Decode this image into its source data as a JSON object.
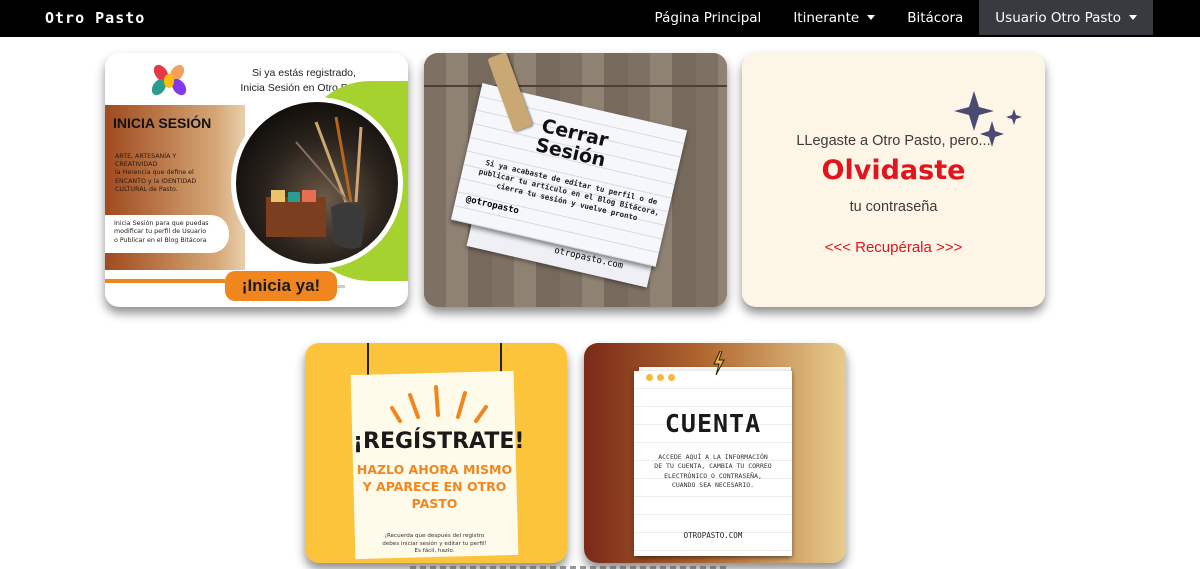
{
  "navbar": {
    "brand": "Otro Pasto",
    "items": [
      {
        "label": "Página Principal"
      },
      {
        "label": "Itinerante"
      },
      {
        "label": "Bitácora"
      },
      {
        "label": "Usuario Otro Pasto"
      }
    ]
  },
  "cards": {
    "login": {
      "top_line1": "Si ya estás registrado,",
      "top_line2": "Inicia Sesión en Otro Pasto",
      "heading": "INICIA SESIÓN",
      "desc1": "ARTE, ARTESANÍA Y",
      "desc2": "CREATIVIDAD",
      "desc3": "la Herencia que define el",
      "desc4": "ENCANTO y la IDENTIDAD",
      "desc5": "CULTURAL de Pasto.",
      "note1": "Inicia Sesión para que puedas",
      "note2": "modificar tu perfil de Usuario",
      "note3": "o Publicar en el Blog Bitácora",
      "cta": "¡Inicia ya!"
    },
    "logout": {
      "title1": "Cerrar",
      "title2": "Sesión",
      "text1": "Si ya acabaste de editar tu perfil o de",
      "text2": "publicar tu artículo en el Blog Bitácora,",
      "text3": "cierra tu sesión y vuelve pronto",
      "handle": "@otropasto",
      "site": "otropasto.com"
    },
    "forgot": {
      "line1": "LLegaste a Otro Pasto, pero...",
      "line2": "Olvidaste",
      "line3": "tu contraseña",
      "link": "<<< Recupérala >>>"
    },
    "register": {
      "title": "¡REGÍSTRATE!",
      "sub1": "HAZLO AHORA MISMO",
      "sub2": "Y APARECE EN OTRO",
      "sub3": "PASTO",
      "note1": "¡Recuerda que después del registro",
      "note2": "debes iniciar sesión y editar tu perfil!",
      "note3": "Es fácil, hazlo."
    },
    "account": {
      "title": "CUENTA",
      "text1": "ACCEDE AQUÍ A LA INFORMACIÓN",
      "text2": "DE TU CUENTA, CAMBIA TU CORREO",
      "text3": "ELECTRÓNICO O CONTRASEÑA,",
      "text4": "CUANDO SEA NECESARIO.",
      "site": "OTROPASTO.COM"
    }
  },
  "colors": {
    "navbar_bg": "#000000",
    "active_nav_bg": "#373a3e",
    "orange_cta": "#f2861e",
    "red_text": "#e1151d",
    "register_yellow": "#fbc43a"
  }
}
